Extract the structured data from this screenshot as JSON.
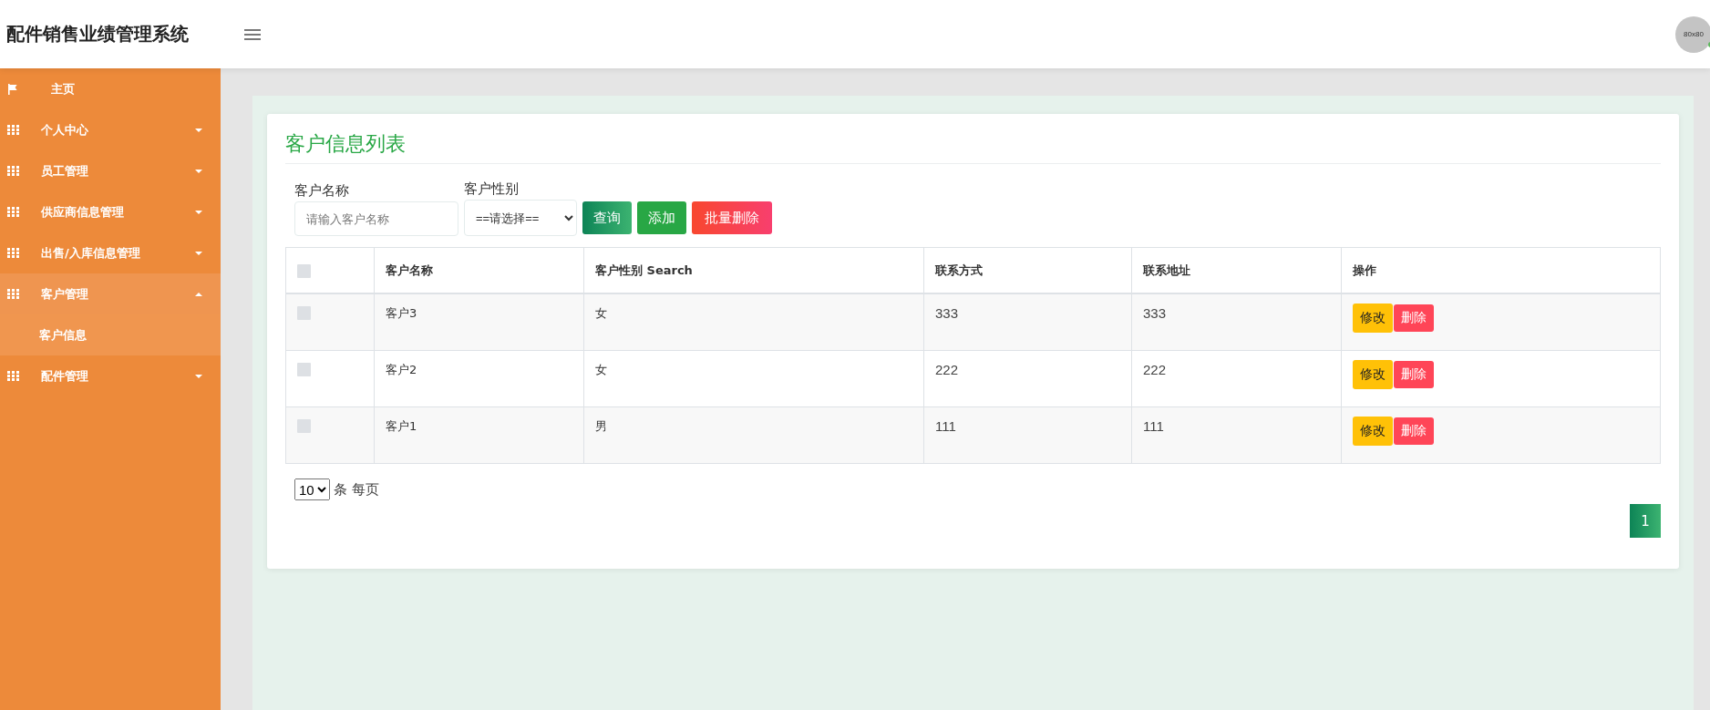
{
  "header": {
    "title": "配件销售业绩管理系统",
    "avatar": {
      "label": "80x80",
      "online": true
    }
  },
  "sidebar": {
    "items": [
      {
        "label": "主页",
        "kind": "flag",
        "expanded": false
      },
      {
        "label": "个人中心",
        "kind": "group",
        "expanded": false
      },
      {
        "label": "员工管理",
        "kind": "group",
        "expanded": false
      },
      {
        "label": "供应商信息管理",
        "kind": "group",
        "expanded": false
      },
      {
        "label": "出售/入库信息管理",
        "kind": "group",
        "expanded": false
      },
      {
        "label": "客户管理",
        "kind": "group",
        "expanded": true,
        "children": [
          {
            "label": "客户信息",
            "selected": true
          }
        ]
      },
      {
        "label": "配件管理",
        "kind": "group",
        "expanded": false
      }
    ]
  },
  "card": {
    "title": "客户信息列表",
    "filters": {
      "name_label": "客户名称",
      "name_placeholder": "请输入客户名称",
      "gender_label": "客户性别",
      "gender_value": "==请选择=="
    },
    "buttons": [
      {
        "label": "查询",
        "kind": "search"
      },
      {
        "label": "添加",
        "kind": "add"
      },
      {
        "label": "批量删除",
        "kind": "danger"
      }
    ],
    "table": {
      "header_checked": false,
      "columns": [
        "客户名称",
        "客户性别 Search",
        "联系方式",
        "联系地址",
        "操作"
      ],
      "rows": [
        {
          "checked": false,
          "cells": [
            "客户3",
            "女",
            "333",
            "333"
          ],
          "actions": [
            "修改",
            "删除"
          ]
        },
        {
          "checked": false,
          "cells": [
            "客户2",
            "女",
            "222",
            "222"
          ],
          "actions": [
            "修改",
            "删除"
          ]
        },
        {
          "checked": false,
          "cells": [
            "客户1",
            "男",
            "111",
            "111"
          ],
          "actions": [
            "修改",
            "删除"
          ]
        }
      ]
    },
    "page_size": {
      "value": "10",
      "suffix": "条 每页"
    },
    "pages": [
      {
        "label": "1",
        "selected": true
      }
    ]
  }
}
